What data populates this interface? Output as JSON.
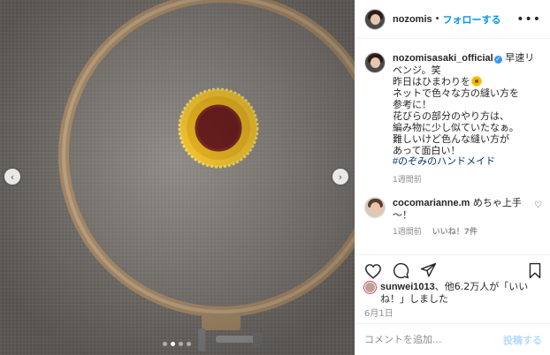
{
  "header": {
    "username": "nozomis",
    "separator": "•",
    "follow_label": "フォローする",
    "more_label": "•••"
  },
  "caption": {
    "username": "nozomisasaki_official",
    "verified_label": "✓",
    "lines": [
      "早速リベンジ。笑",
      "昨日はひまわりを",
      "ネットで色々な方の縫い方を",
      "参考に！",
      "花びらの部分のやり方は、",
      "編み物に少し似ていたなぁ。",
      "難しいけど色んな縫い方が",
      "あって面白い！"
    ],
    "hashtag": "#のぞみのハンドメイド",
    "timestamp": "1週間前"
  },
  "comment": {
    "username": "cocomarianne.m",
    "text": "めちゃ上手～！",
    "timestamp": "1週間前",
    "likes": "いいね！7件"
  },
  "likes_line": {
    "user": "sunwei1013",
    "rest": "、他6.2万人が「いいね！」しました"
  },
  "date": "6月1日",
  "add_comment": {
    "placeholder": "コメントを追加...",
    "post_label": "投稿する"
  },
  "carousel": {
    "prev": "‹",
    "next": "›",
    "total_slides": 4,
    "active_slide": 2
  },
  "colors": {
    "accent": "#0095f6",
    "verified": "#3897f0",
    "hashtag": "#00376b",
    "muted": "#8e8e8e",
    "post_disabled": "#b3dbff"
  },
  "icons": [
    "heart-icon",
    "comment-icon",
    "share-icon",
    "bookmark-icon",
    "more-icon",
    "verified-icon",
    "sunflower-emoji-icon"
  ]
}
